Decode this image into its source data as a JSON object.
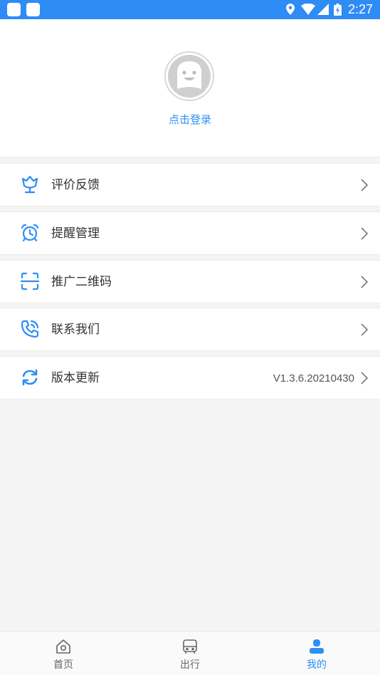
{
  "status_bar": {
    "time": "2:27",
    "color": "#2f8bf5",
    "icons": [
      "location-icon",
      "wifi-icon",
      "signal-icon",
      "battery-icon"
    ]
  },
  "profile": {
    "login_text": "点击登录",
    "avatar_icon": "avatar-smiley-icon"
  },
  "menu": {
    "items": [
      {
        "label": "评价反馈",
        "icon": "tulip-icon",
        "value": ""
      },
      {
        "label": "提醒管理",
        "icon": "alarm-clock-icon",
        "value": ""
      },
      {
        "label": "推广二维码",
        "icon": "scan-icon",
        "value": ""
      },
      {
        "label": "联系我们",
        "icon": "phone-icon",
        "value": ""
      },
      {
        "label": "版本更新",
        "icon": "refresh-icon",
        "value": "V1.3.6.20210430"
      }
    ]
  },
  "tabs": [
    {
      "label": "首页",
      "icon": "home-icon",
      "active": false
    },
    {
      "label": "出行",
      "icon": "bus-icon",
      "active": false
    },
    {
      "label": "我的",
      "icon": "user-icon",
      "active": true
    }
  ],
  "colors": {
    "accent": "#2d8ff5",
    "background": "#f4f4f4",
    "text": "#333333"
  }
}
